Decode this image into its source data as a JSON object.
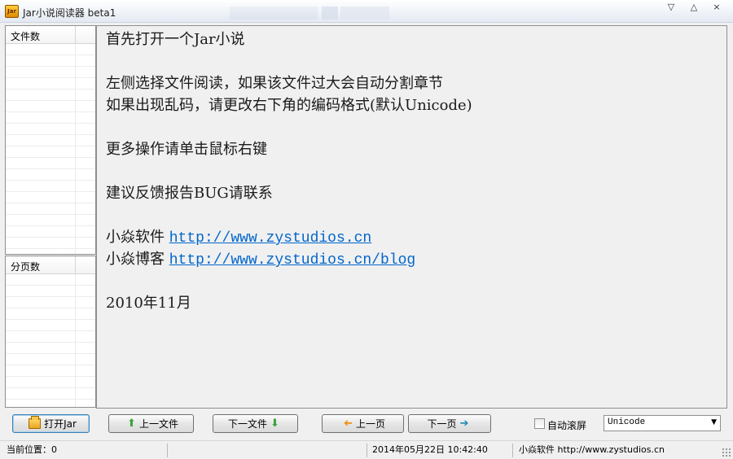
{
  "window": {
    "title": "Jar小说阅读器 beta1",
    "icon_text": "Jar",
    "controls": [
      "▽",
      "△",
      "×"
    ]
  },
  "sidebar": {
    "files_header": "文件数",
    "pages_header": "分页数"
  },
  "content": {
    "lines": {
      "l1": "首先打开一个Jar小说",
      "l2": "左侧选择文件阅读，如果该文件过大会自动分割章节",
      "l3": "如果出现乱码，请更改右下角的编码格式(默认Unicode)",
      "l4": "更多操作请单击鼠标右键",
      "l5": "建议反馈报告BUG请联系",
      "l6_label": "小焱软件 ",
      "l6_link": "http://www.zystudios.cn",
      "l7_label": "小焱博客 ",
      "l7_link": "http://www.zystudios.cn/blog",
      "l8": "2010年11月"
    }
  },
  "toolbar": {
    "open_label": "打开Jar",
    "prev_file_label": "上一文件",
    "next_file_label": "下一文件",
    "prev_page_label": "上一页",
    "next_page_label": "下一页",
    "autoscroll_label": "自动滚屏",
    "autoscroll_checked": false,
    "encoding_value": "Unicode"
  },
  "statusbar": {
    "position": "当前位置：0",
    "datetime": "2014年05月22日 10:42:40",
    "credit": "小焱软件 http://www.zystudios.cn"
  },
  "icons": {
    "up_arrow": "green-up-arrow-icon",
    "down_arrow": "green-down-arrow-icon",
    "left_arrow": "orange-left-arrow-icon",
    "right_arrow": "teal-right-arrow-icon"
  }
}
